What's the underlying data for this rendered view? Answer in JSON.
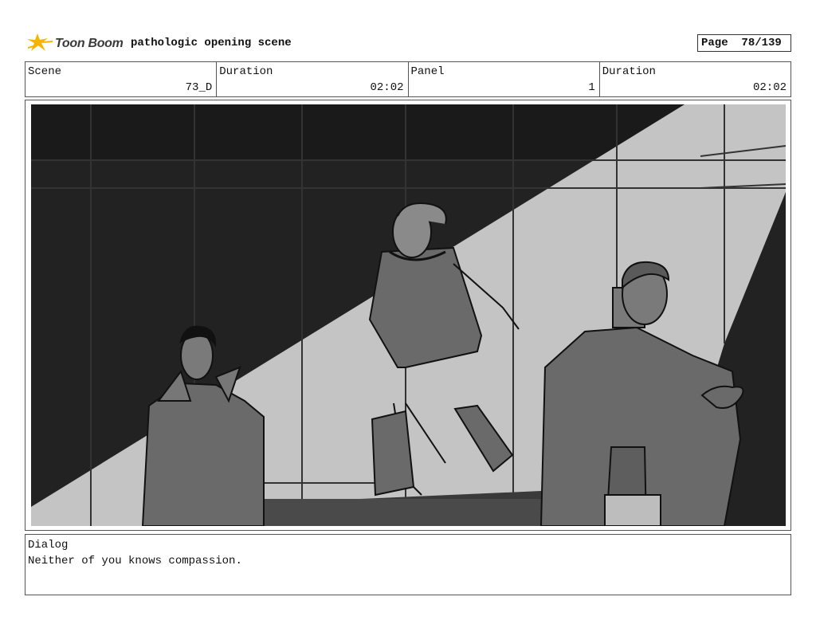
{
  "header": {
    "logo_text": "Toon Boom",
    "logo_icon": "toon-boom-star-icon",
    "project_title": "pathologic opening scene",
    "page_label": "Page",
    "page_value": "78/139"
  },
  "info": {
    "scene_label": "Scene",
    "scene_value": "73_D",
    "duration1_label": "Duration",
    "duration1_value": "02:02",
    "panel_label": "Panel",
    "panel_value": "1",
    "duration2_label": "Duration",
    "duration2_value": "02:02"
  },
  "dialog": {
    "label": "Dialog",
    "text": "Neither of you knows compassion."
  },
  "colors": {
    "logo_star": "#f5b400",
    "dark_bg": "#202020",
    "light_beam": "#c4c4c4",
    "figure_gray": "#6a6a6a"
  }
}
